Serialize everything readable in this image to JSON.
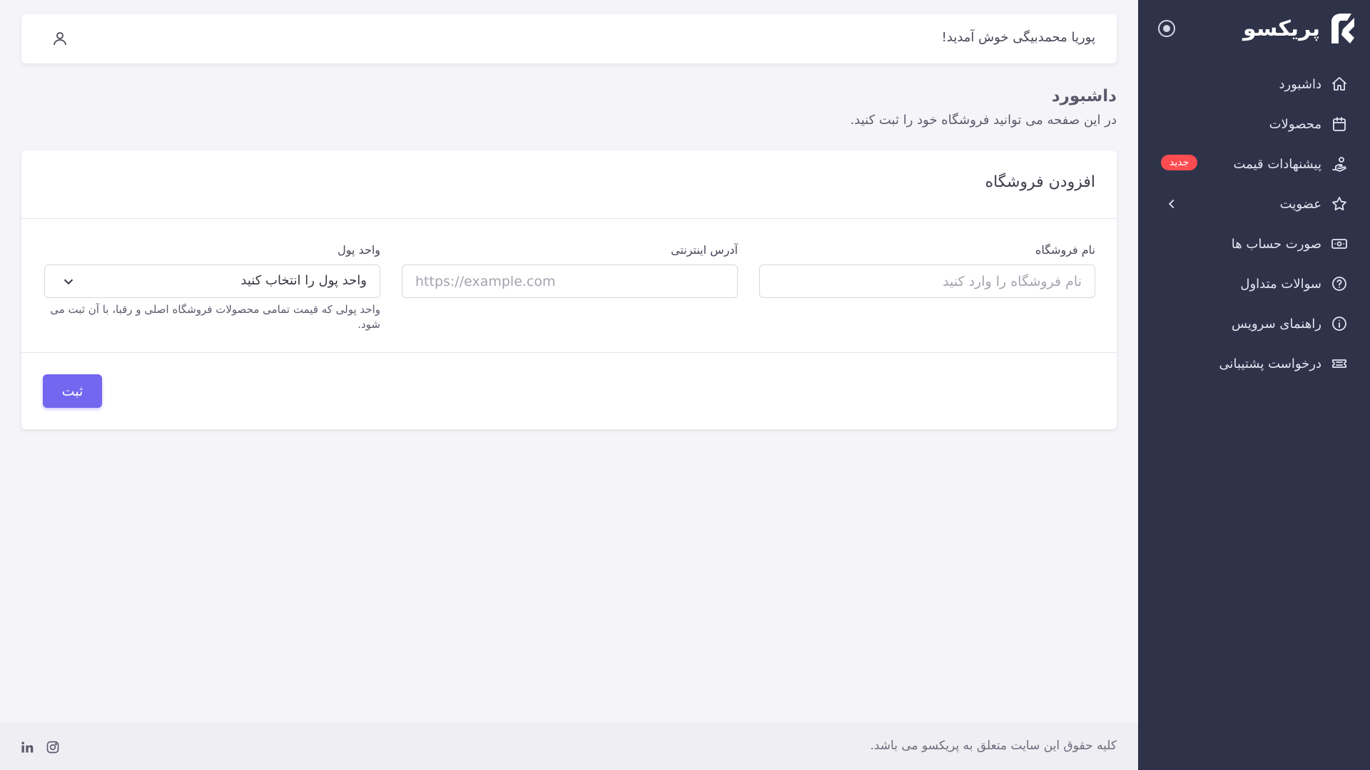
{
  "brand": {
    "name": "پریکسو",
    "color": "#7367f0"
  },
  "sidebar": {
    "background": "#2f3349",
    "items": [
      {
        "label": "داشبورد",
        "icon": "home-icon"
      },
      {
        "label": "محصولات",
        "icon": "calendar-box-icon"
      },
      {
        "label": "پیشنهادات قیمت",
        "icon": "hand-offer-icon",
        "badge": "جدید"
      },
      {
        "label": "عضویت",
        "icon": "star-icon",
        "has_submenu": true
      },
      {
        "label": "صورت حساب ها",
        "icon": "banknote-icon"
      },
      {
        "label": "سوالات متداول",
        "icon": "help-circle-icon"
      },
      {
        "label": "راهنمای سرویس",
        "icon": "info-circle-icon"
      },
      {
        "label": "درخواست پشتیبانی",
        "icon": "ticket-icon"
      }
    ]
  },
  "topbar": {
    "welcome": "پوریا محمدبیگی خوش آمدید!",
    "user_icon": "user-icon"
  },
  "page": {
    "title": "داشبورد",
    "subtitle": "در این صفحه می توانید فروشگاه خود را ثبت کنید."
  },
  "form": {
    "title": "افزودن فروشگاه",
    "store_name": {
      "label": "نام فروشگاه",
      "placeholder": "نام فروشگاه را وارد کنید",
      "value": ""
    },
    "website": {
      "label": "آدرس اینترنتی",
      "placeholder": "https://example.com",
      "value": ""
    },
    "currency": {
      "label": "واحد پول",
      "selected": "واحد پول را انتخاب کنید",
      "help": "واحد پولی که قیمت تمامی محصولات فروشگاه اصلی و رقبا، با آن ثبت می شود."
    },
    "submit_label": "ثبت"
  },
  "footer": {
    "copyright": "کلیه حقوق این سایت متعلق به پریکسو می باشد.",
    "social": [
      "linkedin-icon",
      "instagram-icon"
    ]
  }
}
